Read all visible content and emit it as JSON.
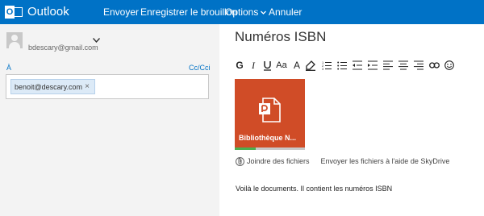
{
  "app": {
    "name": "Outlook",
    "logo_letter": "O"
  },
  "commands": {
    "send": "Envoyer",
    "save_draft": "Enregistrer le brouillon",
    "options": "Options",
    "discard": "Annuler"
  },
  "compose": {
    "from_email": "bdescary@gmail.com",
    "to_label": "À",
    "cc_link": "Cc/Cci",
    "recipients": [
      {
        "address": "benoit@descary.com",
        "remove": "×"
      }
    ],
    "subject": "Numéros ISBN",
    "toolbar": {
      "bold": "G",
      "italic": "I",
      "size": "Aa",
      "font_size": "A",
      "icons": [
        "bold-icon",
        "italic-icon",
        "underline-icon",
        "font-size-icon",
        "grow-font-icon",
        "highlight-icon",
        "font-color-icon",
        "numbered-list-icon",
        "bulleted-list-icon",
        "decrease-indent-icon",
        "increase-indent-icon",
        "align-left-icon",
        "align-center-icon",
        "align-right-icon",
        "link-icon",
        "emoji-icon"
      ]
    },
    "attachment": {
      "name": "Bibliothèque N...",
      "upload_progress": 0.3,
      "accent_color": "#d04c27"
    },
    "attach_actions": {
      "attach_files": "Joindre des fichiers",
      "send_via_skydrive": "Envoyer les fichiers à l'aide de SkyDrive"
    },
    "body": "Voilà le documents. Il contient les numéros ISBN"
  },
  "colors": {
    "topbar": "#0072c6",
    "left_pane": "#f3f3f3",
    "chip": "#dceaf7"
  }
}
